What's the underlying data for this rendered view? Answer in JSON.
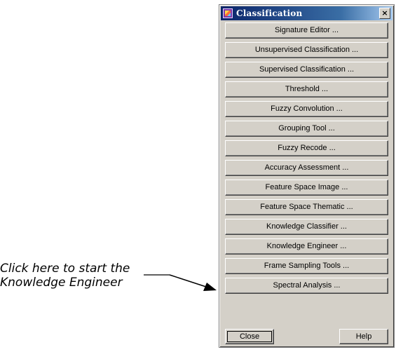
{
  "window": {
    "title": "Classification",
    "close_glyph": "×"
  },
  "buttons": [
    "Signature Editor ...",
    "Unsupervised Classification ...",
    "Supervised Classification ...",
    "Threshold ...",
    "Fuzzy Convolution ...",
    "Grouping Tool ...",
    "Fuzzy Recode ...",
    "Accuracy Assessment ...",
    "Feature Space Image ...",
    "Feature Space Thematic ...",
    "Knowledge Classifier ...",
    "Knowledge Engineer ...",
    "Frame Sampling Tools ...",
    "Spectral Analysis ..."
  ],
  "footer": {
    "close_label": "Close",
    "help_label": "Help"
  },
  "annotation": {
    "line1": "Click here to start the",
    "line2": "Knowledge Engineer"
  },
  "colors": {
    "window_bg": "#d4d0c8",
    "title_start": "#0a246a",
    "title_end": "#a6caf0"
  }
}
